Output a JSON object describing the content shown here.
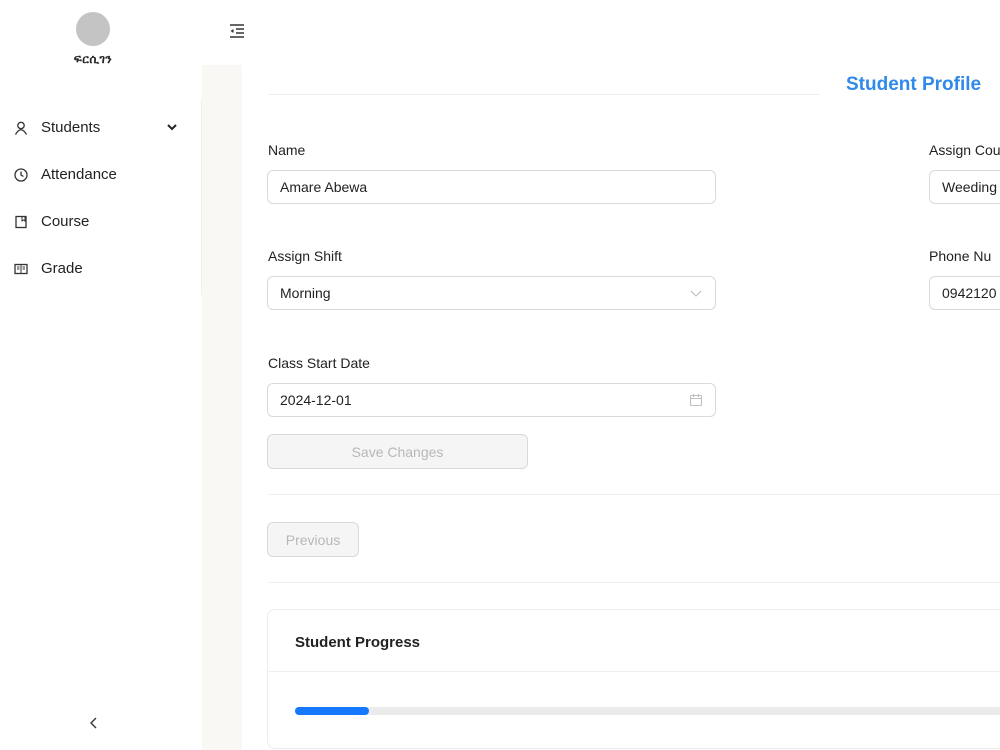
{
  "sidebar": {
    "logo_text": "ፍርሲገን",
    "items": [
      {
        "label": "Students",
        "icon": "user-icon",
        "has_submenu": true
      },
      {
        "label": "Attendance",
        "icon": "clock-icon"
      },
      {
        "label": "Course",
        "icon": "book-icon"
      },
      {
        "label": "Grade",
        "icon": "open-book-icon"
      }
    ],
    "collapse_icon": "chevron-left-icon"
  },
  "header": {
    "menu_toggle_icon": "menu-fold-icon"
  },
  "page": {
    "title": "Student Profile"
  },
  "form": {
    "name": {
      "label": "Name",
      "value": "Amare Abewa"
    },
    "assign_course": {
      "label": "Assign Cou",
      "value": "Weeding"
    },
    "assign_shift": {
      "label": "Assign Shift",
      "value": "Morning"
    },
    "phone_number": {
      "label": "Phone Nu",
      "value": "0942120"
    },
    "class_start_date": {
      "label": "Class Start Date",
      "value": "2024-12-01"
    },
    "save_label": "Save Changes"
  },
  "nav": {
    "previous_label": "Previous"
  },
  "progress": {
    "title": "Student Progress",
    "fraction": 0.1
  },
  "colors": {
    "accent": "#2f8ae9",
    "progress": "#1677ff",
    "content_bg": "#f9f8f4"
  }
}
